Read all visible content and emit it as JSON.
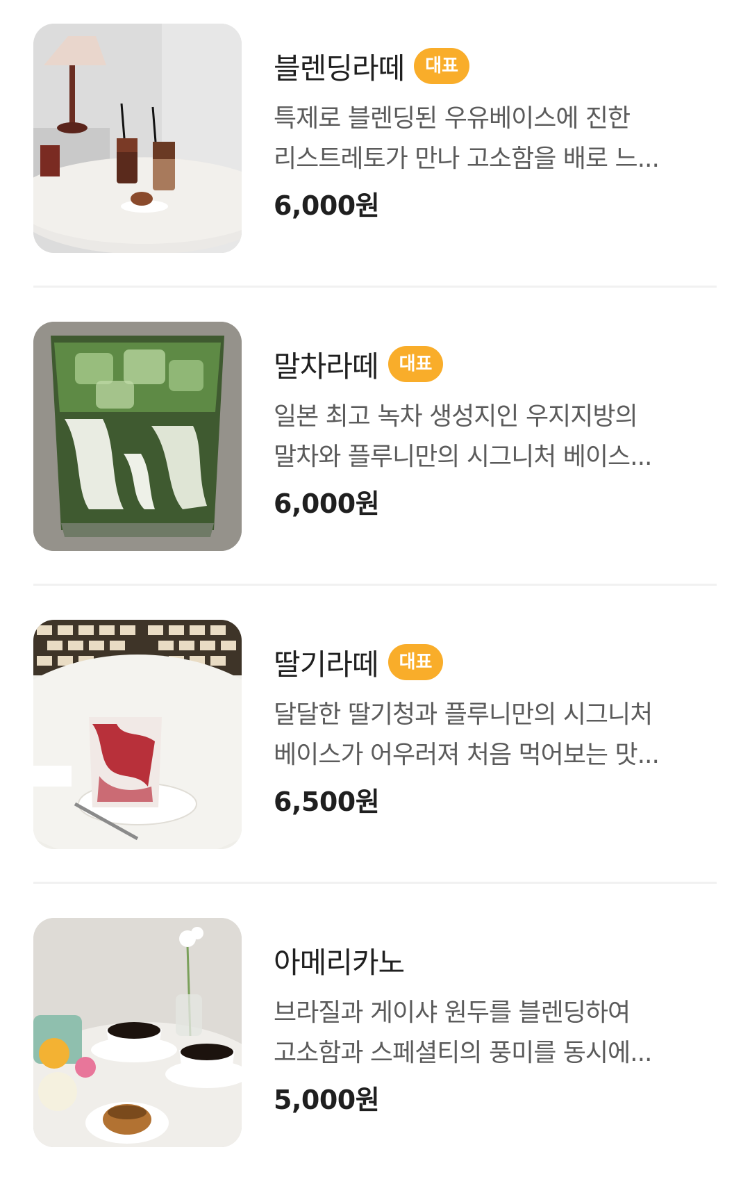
{
  "menu": {
    "items": [
      {
        "name": "블렌딩라떼",
        "badge": "대표",
        "desc_line1": "특제로 블렌딩된 우유베이스에 진한",
        "desc_line2": "리스트레토가 만나 고소함을 배로 느...",
        "price": "6,000원",
        "image": "iced-coffee-latte-photo"
      },
      {
        "name": "말차라떼",
        "badge": "대표",
        "desc_line1": "일본 최고 녹차 생성지인 우지지방의",
        "desc_line2": "말차와 플루니만의 시그니처 베이스...",
        "price": "6,000원",
        "image": "matcha-latte-photo"
      },
      {
        "name": "딸기라떼",
        "badge": "대표",
        "desc_line1": "달달한 딸기청과 플루니만의 시그니처",
        "desc_line2": "베이스가 어우러져 처음 먹어보는 맛...",
        "price": "6,500원",
        "image": "strawberry-latte-photo"
      },
      {
        "name": "아메리카노",
        "desc_line1": "브라질과 게이샤 원두를 블렌딩하여",
        "desc_line2": "고소함과 스페셜티의 풍미를 동시에...",
        "price": "5,000원",
        "image": "americano-photo"
      }
    ]
  },
  "colors": {
    "badge_bg": "#f9ad2a",
    "text_primary": "#1f1f1f",
    "text_secondary": "#5b5b5b",
    "divider": "#f1f1f1"
  }
}
